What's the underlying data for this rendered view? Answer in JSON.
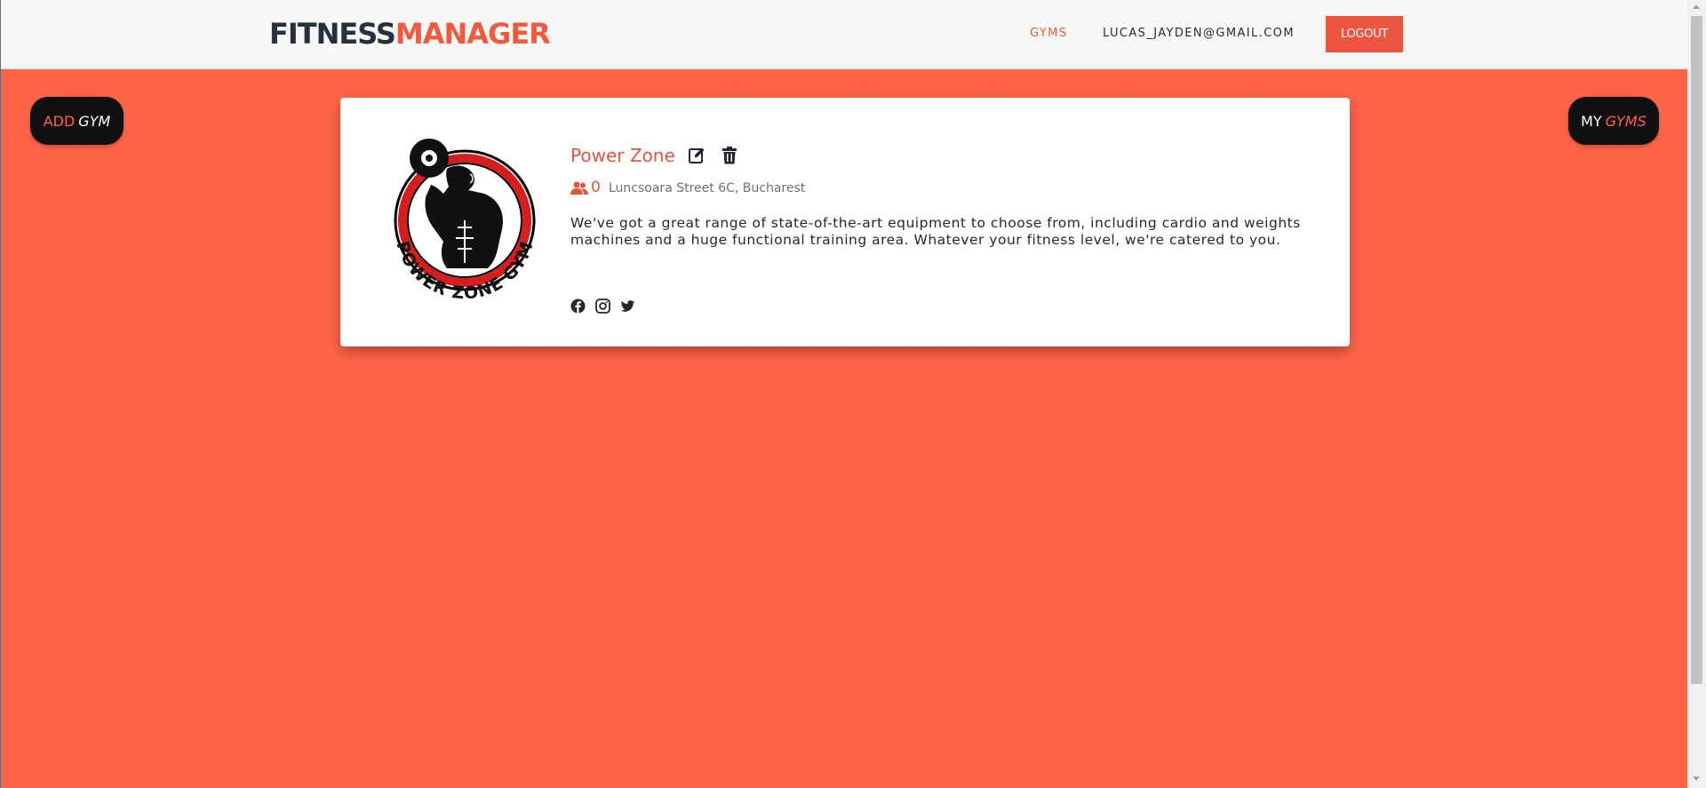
{
  "app": {
    "brand_part1": "FITNESS",
    "brand_part2": "MANAGER"
  },
  "nav": {
    "gyms_label": "GYMS",
    "user_email": "LUCAS_JAYDEN@GMAIL.COM",
    "logout_label": "LOGOUT"
  },
  "actions": {
    "add_gym_word1": "ADD",
    "add_gym_word2": "GYM",
    "my_gyms_word1": "MY",
    "my_gyms_word2": "GYMS"
  },
  "gym": {
    "name": "Power Zone",
    "members_count": "0",
    "address": "Luncsoara Street 6C, Bucharest",
    "description": "We've got a great range of state-of-the-art equipment to choose from, including cardio and weights machines and a huge functional training area. Whatever your fitness level, we're catered to you.",
    "logo_text": "POWER ZONE GYM"
  },
  "icons": {
    "edit": "edit-icon",
    "delete": "trash-icon",
    "members": "users-icon",
    "facebook": "facebook-icon",
    "instagram": "instagram-icon",
    "twitter": "twitter-icon"
  },
  "colors": {
    "accent": "#ec5640",
    "background": "#ff6448",
    "brand_dark": "#26313f",
    "pill": "#111111"
  }
}
